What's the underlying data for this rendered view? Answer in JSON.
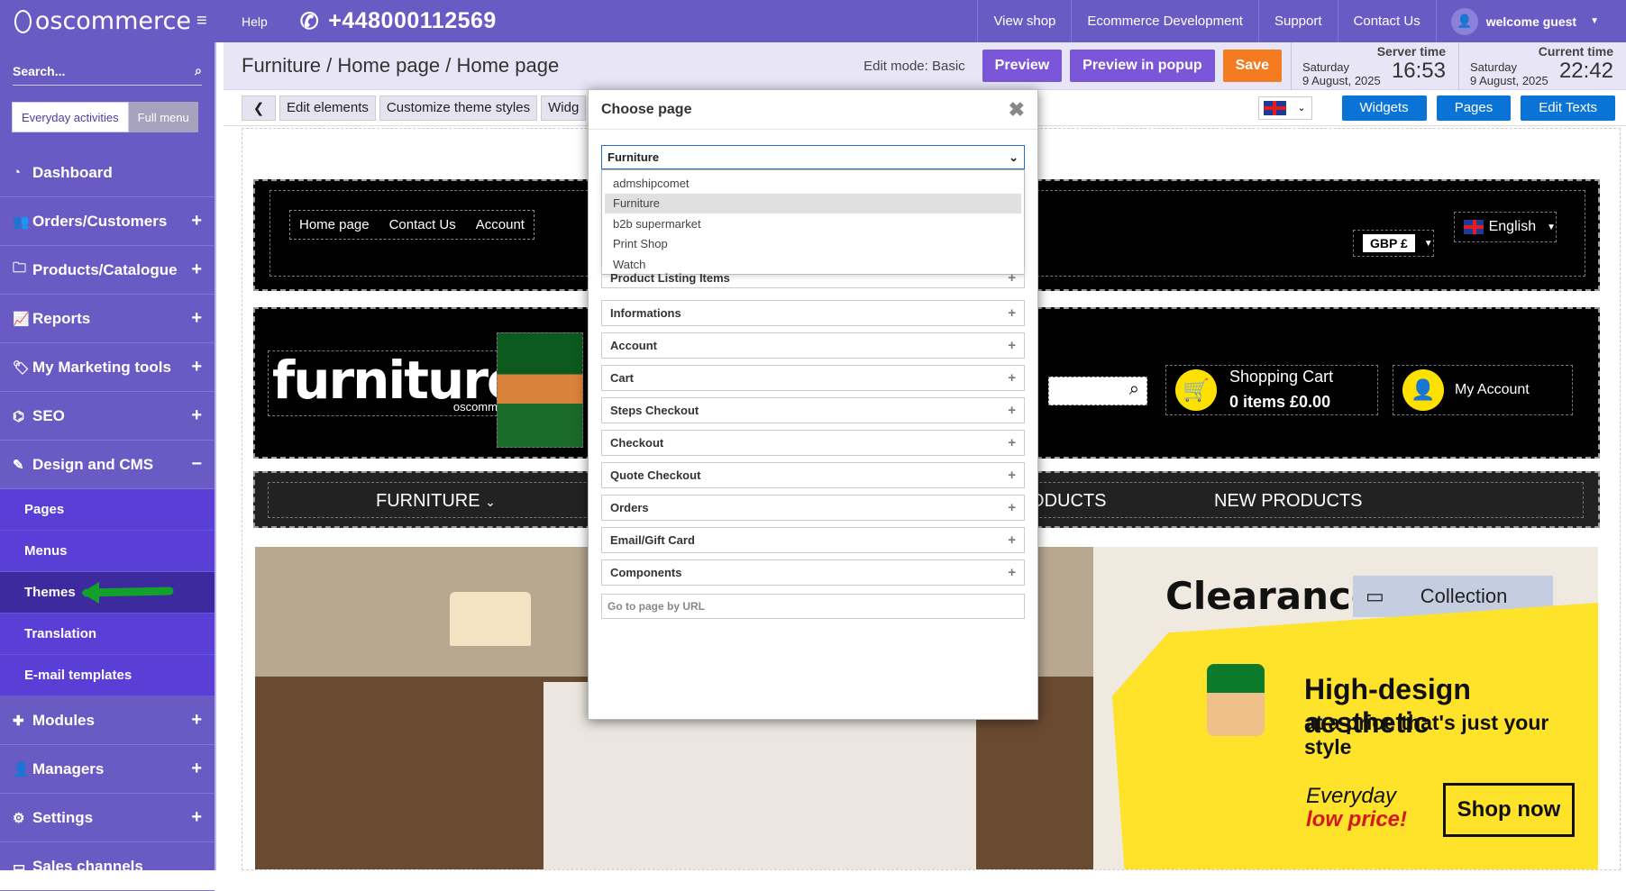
{
  "topbar": {
    "brand": "oscommerce",
    "help": "Help",
    "phone": "+448000112569",
    "nav": [
      "View shop",
      "Ecommerce Development",
      "Support",
      "Contact Us"
    ],
    "user": "welcome guest"
  },
  "sidebar": {
    "search_placeholder": "Search...",
    "mode_everyday": "Everyday activities",
    "mode_full": "Full menu",
    "items": [
      {
        "label": "Dashboard"
      },
      {
        "label": "Orders/Customers"
      },
      {
        "label": "Products/Catalogue"
      },
      {
        "label": "Reports"
      },
      {
        "label": "My Marketing tools"
      },
      {
        "label": "SEO"
      },
      {
        "label": "Design and CMS"
      },
      {
        "label": "Modules"
      },
      {
        "label": "Managers"
      },
      {
        "label": "Settings"
      },
      {
        "label": "Sales channels"
      }
    ],
    "sub_items": [
      "Pages",
      "Menus",
      "Themes",
      "Translation",
      "E-mail templates"
    ]
  },
  "header": {
    "breadcrumb": "Furniture / Home page / Home page",
    "edit_mode": "Edit mode: Basic",
    "preview": "Preview",
    "preview_popup": "Preview in popup",
    "save": "Save",
    "server_time_label": "Server time",
    "server_day": "Saturday",
    "server_date": "9 August, 2025",
    "server_clock": "16:53",
    "current_time_label": "Current time",
    "current_day": "Saturday",
    "current_date": "9 August, 2025",
    "current_clock": "22:42"
  },
  "toolbar": {
    "edit_elements": "Edit elements",
    "customize": "Customize theme styles",
    "widgets_tab": "Widg",
    "widgets": "Widgets",
    "pages": "Pages",
    "edit_texts": "Edit Texts"
  },
  "preview": {
    "nav_links": [
      "Home page",
      "Contact Us",
      "Account"
    ],
    "currency": "GBP £",
    "language": "English",
    "logo_text": "furniture",
    "logo_sub": "oscommerce",
    "cart_title": "Shopping Cart",
    "cart_value": "0 items £0.00",
    "my_account": "My Account",
    "menu": [
      "FURNITURE",
      "URED PRODUCTS",
      "NEW PRODUCTS"
    ],
    "clearance": "Clearance",
    "collection": "Collection",
    "headline": "High-design aesthetic",
    "subline": "at a price that's just your style",
    "everyday": "Everyday",
    "low_price": "low price!",
    "shop_now": "Shop now"
  },
  "modal": {
    "title": "Choose page",
    "selected": "Furniture",
    "options": [
      "admshipcomet",
      "Furniture",
      "b2b supermarket",
      "Print Shop",
      "Watch"
    ],
    "sections": [
      "Product Listing Items",
      "Informations",
      "Account",
      "Cart",
      "Steps Checkout",
      "Checkout",
      "Quote Checkout",
      "Orders",
      "Email/Gift Card",
      "Components"
    ],
    "url_placeholder": "Go to page by URL"
  },
  "colors": {
    "brand": "#6a5bc4",
    "save": "#f47b20",
    "blue_button": "#0a74d6",
    "annotation_arrow": "#12a12a"
  }
}
